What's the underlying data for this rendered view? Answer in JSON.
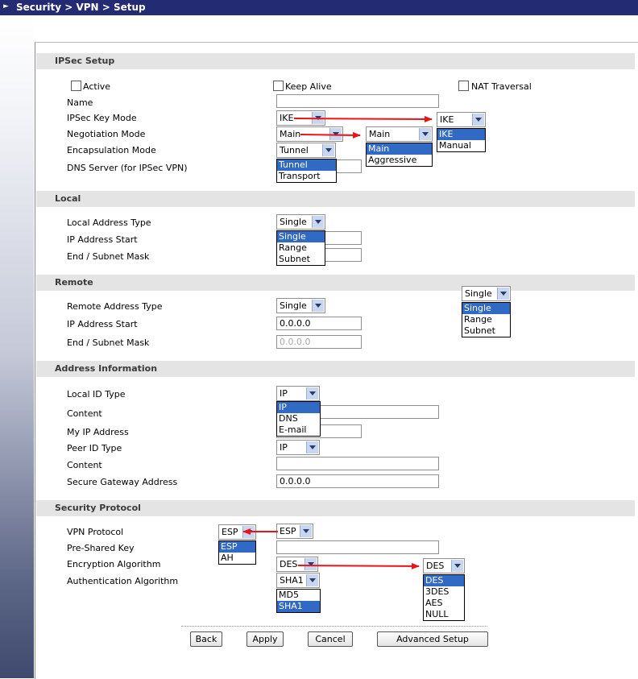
{
  "breadcrumb": "Security > VPN > Setup",
  "ipsec": {
    "header": "IPSec Setup",
    "active": "Active",
    "keep_alive": "Keep Alive",
    "nat_traversal": "NAT Traversal",
    "name_label": "Name",
    "key_mode_label": "IPSec Key Mode",
    "key_mode_value": "IKE",
    "key_mode_open_value": "IKE",
    "key_mode_options": [
      "IKE",
      "Manual"
    ],
    "negotiation_label": "Negotiation Mode",
    "negotiation_value": "Main",
    "negotiation_open_value": "Main",
    "negotiation_options": [
      "Main",
      "Aggressive"
    ],
    "encapsulation_label": "Encapsulation Mode",
    "encapsulation_value": "Tunnel",
    "encapsulation_options": [
      "Tunnel",
      "Transport"
    ],
    "dns_label": "DNS Server (for IPSec VPN)"
  },
  "local": {
    "header": "Local",
    "address_type_label": "Local Address Type",
    "address_type_value": "Single",
    "address_type_options": [
      "Single",
      "Range",
      "Subnet"
    ],
    "ip_start_label": "IP Address Start",
    "end_label": "End / Subnet Mask"
  },
  "remote": {
    "header": "Remote",
    "address_type_label": "Remote Address Type",
    "address_type_value": "Single",
    "address_type_open_value": "Single",
    "address_type_options": [
      "Single",
      "Range",
      "Subnet"
    ],
    "ip_start_label": "IP Address Start",
    "ip_start_value": "0.0.0.0",
    "end_label": "End / Subnet Mask",
    "end_value": "0.0.0.0"
  },
  "address_info": {
    "header": "Address Information",
    "local_id_type_label": "Local ID Type",
    "local_id_type_value": "IP",
    "local_id_type_options": [
      "IP",
      "DNS",
      "E-mail"
    ],
    "content_label": "Content",
    "my_ip_label": "My IP Address",
    "peer_id_type_label": "Peer ID Type",
    "peer_id_type_value": "IP",
    "content2_label": "Content",
    "gateway_label": "Secure Gateway Address",
    "gateway_value": "0.0.0.0"
  },
  "security": {
    "header": "Security Protocol",
    "vpn_protocol_label": "VPN Protocol",
    "vpn_protocol_value": "ESP",
    "vpn_protocol_open_value": "ESP",
    "vpn_protocol_options": [
      "ESP",
      "AH"
    ],
    "psk_label": "Pre-Shared Key",
    "encryption_label": "Encryption Algorithm",
    "encryption_value": "DES",
    "encryption_open_value": "DES",
    "encryption_options": [
      "DES",
      "3DES",
      "AES",
      "NULL"
    ],
    "auth_label": "Authentication Algorithm",
    "auth_value": "SHA1",
    "auth_options": [
      "MD5",
      "SHA1"
    ]
  },
  "buttons": {
    "back": "Back",
    "apply": "Apply",
    "cancel": "Cancel",
    "advanced": "Advanced Setup"
  },
  "colors": {
    "titlebar": "#232c73",
    "section_bg": "#e4e4e4",
    "highlight": "#316ac5",
    "arrow": "#e8141a"
  }
}
